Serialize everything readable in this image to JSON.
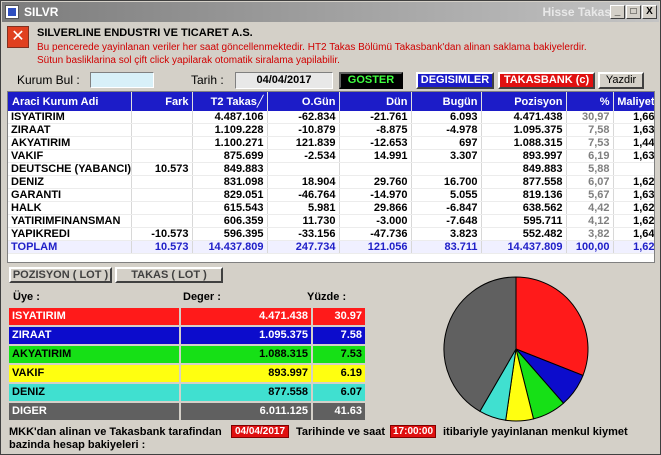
{
  "window": {
    "title_left": "SILVR",
    "title_right": "Hisse Takas",
    "min": "_",
    "max": "□",
    "close": "X"
  },
  "info": {
    "company": "SILVERLINE ENDUSTRI VE TICARET A.S.",
    "line1": "Bu pencerede yayinlanan veriler  her saat göncellenmektedir. HT2 Takas Bölümü Takasbank'dan alinan saklama bakiyelerdir.",
    "line2": "Sütun basliklarina sol çift click yapilarak otomatik siralama yapilabilir."
  },
  "toolbar": {
    "kurum_label": "Kurum Bul :",
    "kurum_value": "",
    "tarih_label": "Tarih :",
    "tarih_value": "04/04/2017",
    "goster": "GOSTER",
    "degisimler": "DEGISIMLER",
    "takasbank": "TAKASBANK (c)",
    "yazdir": "Yazdir"
  },
  "colors": {
    "header": "#1c1cc8",
    "red": "#ff1a1a",
    "blue": "#0c0ccc",
    "green": "#16e016",
    "yellow": "#ffff10",
    "cyan": "#40e0d0",
    "gray": "#606060"
  },
  "table": {
    "headers": [
      "Araci Kurum Adi",
      "Fark",
      "T2 Takas╱",
      "O.Gün",
      "Dün",
      "Bugün",
      "Pozisyon",
      "%",
      "Maliyet"
    ],
    "rows": [
      [
        "ISYATIRIM",
        "",
        "4.487.106",
        "-62.834",
        "-21.761",
        "6.093",
        "4.471.438",
        "30,97",
        "1,66"
      ],
      [
        "ZIRAAT",
        "",
        "1.109.228",
        "-10.879",
        "-8.875",
        "-4.978",
        "1.095.375",
        "7,58",
        "1,63"
      ],
      [
        "AKYATIRIM",
        "",
        "1.100.271",
        "121.839",
        "-12.653",
        "697",
        "1.088.315",
        "7,53",
        "1,44"
      ],
      [
        "VAKIF",
        "",
        "875.699",
        "-2.534",
        "14.991",
        "3.307",
        "893.997",
        "6,19",
        "1,63"
      ],
      [
        "DEUTSCHE (YABANCI)",
        "10.573",
        "849.883",
        "",
        "",
        "",
        "849.883",
        "5,88",
        ""
      ],
      [
        "DENIZ",
        "",
        "831.098",
        "18.904",
        "29.760",
        "16.700",
        "877.558",
        "6,07",
        "1,62"
      ],
      [
        "GARANTI",
        "",
        "829.051",
        "-46.764",
        "-14.970",
        "5.055",
        "819.136",
        "5,67",
        "1,63"
      ],
      [
        "HALK",
        "",
        "615.543",
        "5.981",
        "29.866",
        "-6.847",
        "638.562",
        "4,42",
        "1,62"
      ],
      [
        "YATIRIMFINANSMAN",
        "",
        "606.359",
        "11.730",
        "-3.000",
        "-7.648",
        "595.711",
        "4,12",
        "1,62"
      ],
      [
        "YAPIKREDI",
        "-10.573",
        "596.395",
        "-33.156",
        "-47.736",
        "3.823",
        "552.482",
        "3,82",
        "1,64"
      ]
    ],
    "total": [
      "TOPLAM",
      "10.573",
      "14.437.809",
      "247.734",
      "121.056",
      "83.711",
      "14.437.809",
      "100,00",
      "1,62"
    ]
  },
  "tabs": {
    "pozisyon": "POZISYON ( LOT )",
    "takas": "TAKAS ( LOT )"
  },
  "summary": {
    "h_uye": "Üye            :",
    "h_deger": "Deger           :",
    "h_yuzde": "Yüzde   :",
    "rows": [
      {
        "name": "ISYATIRIM",
        "value": "4.471.438",
        "pct": "30.97",
        "share": 30.97,
        "color": "#ff1a1a",
        "fg": "#ffffff"
      },
      {
        "name": "ZIRAAT",
        "value": "1.095.375",
        "pct": "7.58",
        "share": 7.58,
        "color": "#0c0ccc",
        "fg": "#ffffff"
      },
      {
        "name": "AKYATIRIM",
        "value": "1.088.315",
        "pct": "7.53",
        "share": 7.53,
        "color": "#16e016",
        "fg": "#000000"
      },
      {
        "name": "VAKIF",
        "value": "893.997",
        "pct": "6.19",
        "share": 6.19,
        "color": "#ffff10",
        "fg": "#000000"
      },
      {
        "name": "DENIZ",
        "value": "877.558",
        "pct": "6.07",
        "share": 6.07,
        "color": "#40e0d0",
        "fg": "#000000"
      },
      {
        "name": "DIGER",
        "value": "6.011.125",
        "pct": "41.63",
        "share": 41.63,
        "color": "#606060",
        "fg": "#ffffff"
      }
    ]
  },
  "footer": {
    "text1": "MKK'dan alinan ve Takasbank tarafindan",
    "date": "04/04/2017",
    "text2": "Tarihinde ve saat",
    "time": "17:00:00",
    "text3": "itibariyle yayinlanan menkul kiymet",
    "text4": "bazinda hesap bakiyeleri :"
  }
}
